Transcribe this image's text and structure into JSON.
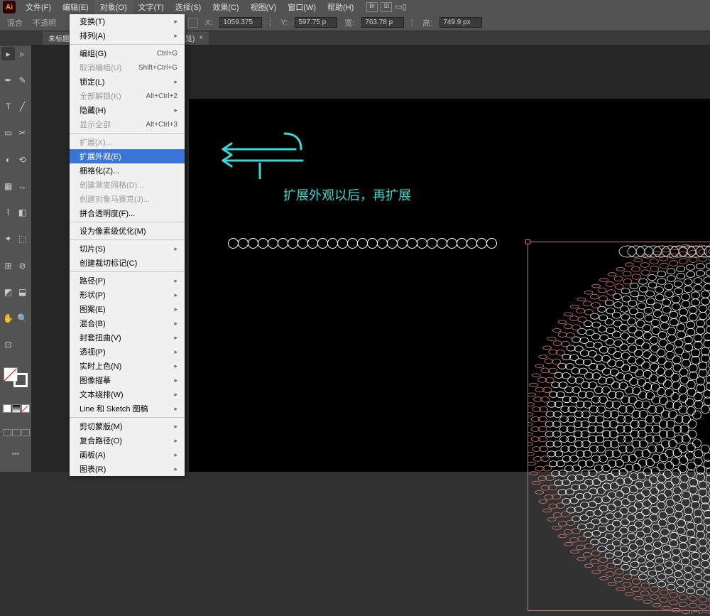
{
  "app": {
    "iconLetters": "Ai"
  },
  "menu": {
    "items": [
      "文件(F)",
      "编辑(E)",
      "对象(O)",
      "文字(T)",
      "选择(S)",
      "效果(C)",
      "视图(V)",
      "窗口(W)",
      "帮助(H)"
    ]
  },
  "controlbar": {
    "leftLabel": "混合",
    "opacityLabel": "不透明",
    "x": "1059.375",
    "y": "597.75 p",
    "w": "763.78 p",
    "h": "749.9 px",
    "xLbl": "X:",
    "yLbl": "Y:",
    "wLbl": "宽:",
    "hLbl": "高:"
  },
  "tab": {
    "title": "未标题-1 旧… 器 1* @ 150% (RGB/GPU 预览)",
    "close": "×"
  },
  "annotation": "扩展外观以后，再扩展",
  "dropdown": {
    "groups": [
      [
        {
          "label": "变换(T)",
          "sub": true
        },
        {
          "label": "排列(A)",
          "sub": true
        }
      ],
      [
        {
          "label": "编组(G)",
          "shortcut": "Ctrl+G"
        },
        {
          "label": "取消编组(U)",
          "shortcut": "Shift+Ctrl+G",
          "disabled": true
        },
        {
          "label": "锁定(L)",
          "sub": true
        },
        {
          "label": "全部解锁(K)",
          "shortcut": "Alt+Ctrl+2",
          "disabled": true
        },
        {
          "label": "隐藏(H)",
          "sub": true
        },
        {
          "label": "显示全部",
          "shortcut": "Alt+Ctrl+3",
          "disabled": true
        }
      ],
      [
        {
          "label": "扩展(X)...",
          "disabled": true
        },
        {
          "label": "扩展外观(E)",
          "hovered": true
        },
        {
          "label": "栅格化(Z)..."
        },
        {
          "label": "创建渐变网格(D)...",
          "disabled": true
        },
        {
          "label": "创建对象马赛克(J)...",
          "disabled": true
        },
        {
          "label": "拼合透明度(F)..."
        }
      ],
      [
        {
          "label": "设为像素级优化(M)"
        }
      ],
      [
        {
          "label": "切片(S)",
          "sub": true
        },
        {
          "label": "创建裁切标记(C)"
        }
      ],
      [
        {
          "label": "路径(P)",
          "sub": true
        },
        {
          "label": "形状(P)",
          "sub": true
        },
        {
          "label": "图案(E)",
          "sub": true
        },
        {
          "label": "混合(B)",
          "sub": true
        },
        {
          "label": "封套扭曲(V)",
          "sub": true
        },
        {
          "label": "透视(P)",
          "sub": true
        },
        {
          "label": "实时上色(N)",
          "sub": true
        },
        {
          "label": "图像描摹",
          "sub": true
        },
        {
          "label": "文本绕排(W)",
          "sub": true
        },
        {
          "label": "Line 和 Sketch 图稿",
          "sub": true
        }
      ],
      [
        {
          "label": "剪切蒙版(M)",
          "sub": true
        },
        {
          "label": "复合路径(O)",
          "sub": true
        },
        {
          "label": "画板(A)",
          "sub": true
        },
        {
          "label": "图表(R)",
          "sub": true
        }
      ]
    ]
  },
  "tools": [
    "▸",
    "▹",
    "✒",
    "✎",
    "T",
    "╱",
    "▭",
    "✂",
    "◐",
    "⟲",
    "▦",
    "↔",
    "⌇",
    "◧",
    "✦",
    "⬚",
    "⊞",
    "⊘",
    "◩",
    "⬓",
    "✋",
    "🔍",
    "⊡"
  ]
}
